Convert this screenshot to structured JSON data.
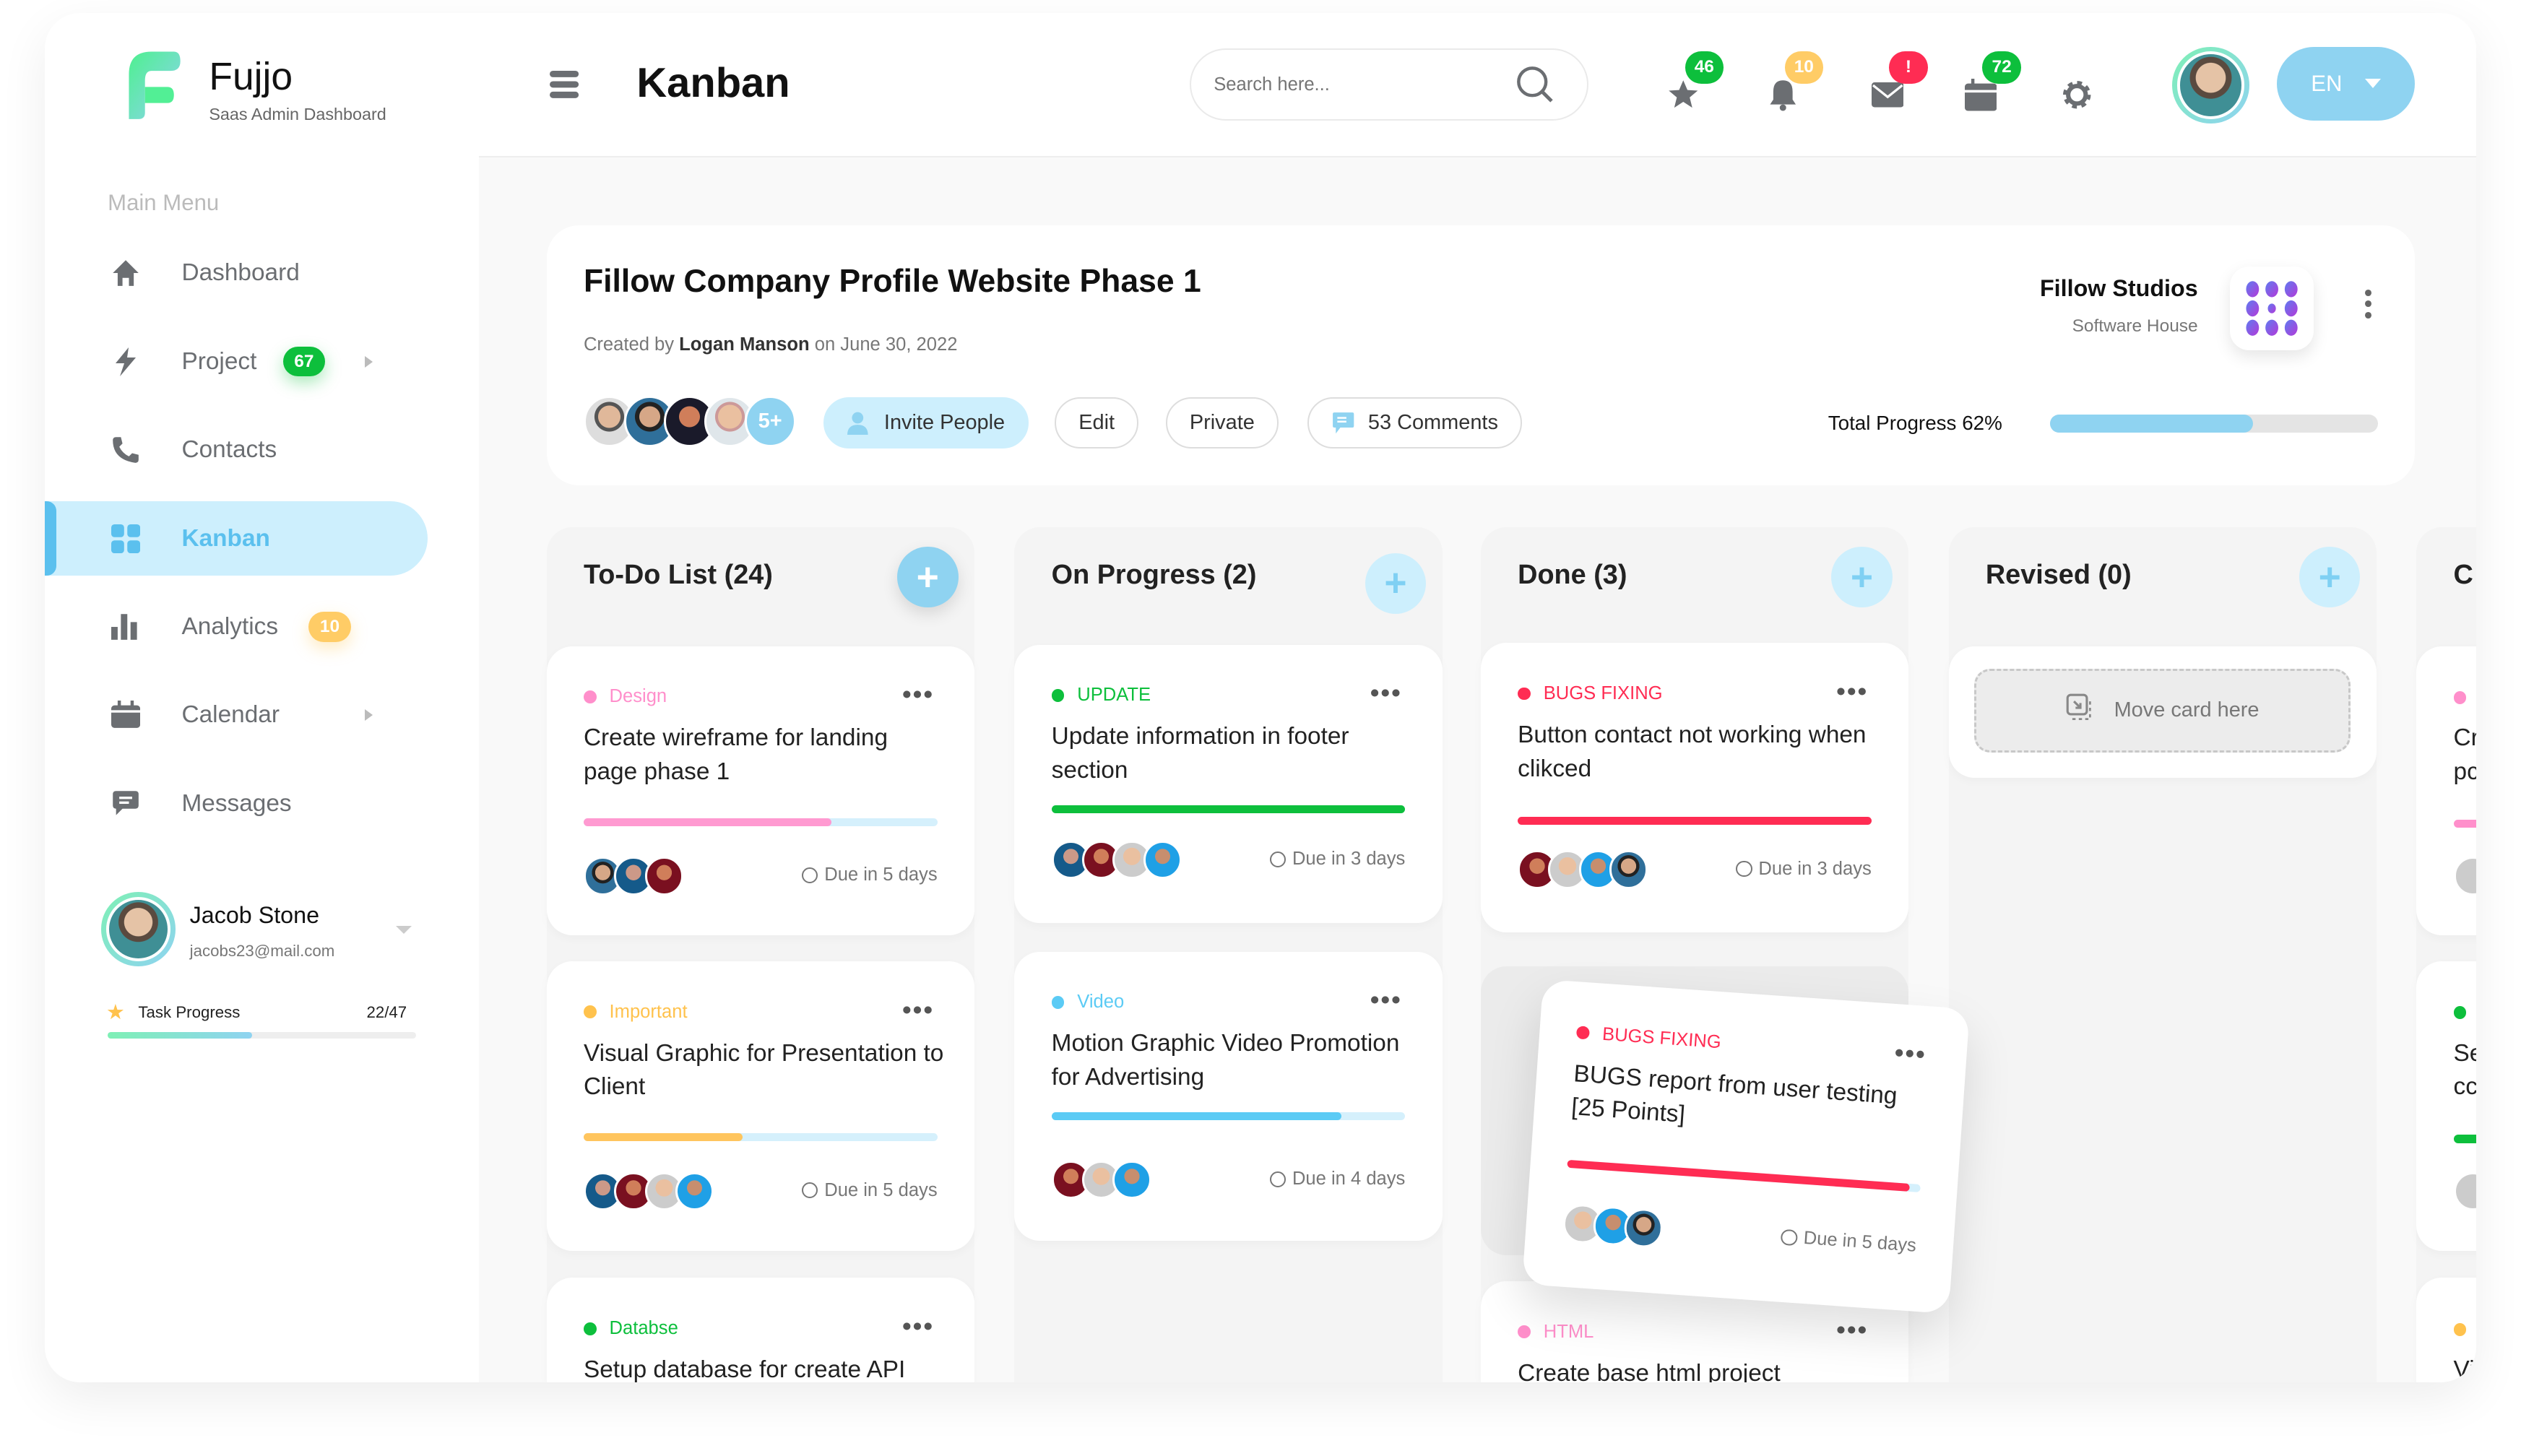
{
  "brand": {
    "name": "Fujjo",
    "subtitle": "Saas Admin Dashboard"
  },
  "sidebar": {
    "section_label": "Main Menu",
    "items": [
      {
        "label": "Dashboard",
        "icon": "home-icon"
      },
      {
        "label": "Project",
        "icon": "lightning-icon",
        "badge": "67",
        "badge_color": "#0dbf3c",
        "has_submenu": true
      },
      {
        "label": "Contacts",
        "icon": "phone-icon"
      },
      {
        "label": "Kanban",
        "icon": "grid-icon",
        "active": true
      },
      {
        "label": "Analytics",
        "icon": "bar-chart-icon",
        "badge": "10",
        "badge_color": "#ffcc66"
      },
      {
        "label": "Calendar",
        "icon": "calendar-icon",
        "has_submenu": true
      },
      {
        "label": "Messages",
        "icon": "message-icon"
      }
    ],
    "user": {
      "name": "Jacob Stone",
      "email": "jacobs23@mail.com",
      "task_progress_label": "Task Progress",
      "task_progress": "22/47",
      "task_progress_fraction": 0.468
    }
  },
  "header": {
    "title": "Kanban",
    "search_placeholder": "Search here...",
    "icons": [
      {
        "name": "star-icon",
        "badge": "46",
        "badge_color": "#0dbf3c"
      },
      {
        "name": "bell-icon",
        "badge": "10",
        "badge_color": "#ffcc66"
      },
      {
        "name": "mail-icon",
        "badge": "!",
        "badge_color": "#ff2c53"
      },
      {
        "name": "calendar-icon",
        "badge": "72",
        "badge_color": "#0dbf3c"
      },
      {
        "name": "gear-icon"
      }
    ],
    "language": "EN"
  },
  "project": {
    "title": "Fillow Company Profile Website Phase 1",
    "created_prefix": "Created by",
    "author": "Logan Manson",
    "created_suffix": "on June 30, 2022",
    "more_members": "5+",
    "invite_label": "Invite People",
    "edit_label": "Edit",
    "private_label": "Private",
    "comments_label": "53 Comments",
    "company": "Fillow Studios",
    "company_type": "Software House",
    "progress_label": "Total Progress 62%",
    "progress": 62
  },
  "accent": "#8fd3f1",
  "columns": [
    {
      "title": "To-Do List (24)",
      "cards": [
        {
          "tag": "Design",
          "tag_color": "#ff8fcb",
          "title": "Create wireframe for landing page phase 1",
          "progress": 70,
          "bar_color": "#ff9ad1",
          "due": "Due in 5 days",
          "avatars": 3
        },
        {
          "tag": "Important",
          "tag_color": "#ffc24d",
          "title": "Visual Graphic for Presentation to Client",
          "progress": 45,
          "bar_color": "#ffc55e",
          "due": "Due in 5 days",
          "avatars": 4
        },
        {
          "tag": "Databse",
          "tag_color": "#0dbf3c",
          "title": "Setup database for create API",
          "progress": 0,
          "bar_color": "#0dbf3c",
          "due": "",
          "avatars": 0
        }
      ]
    },
    {
      "title": "On Progress (2)",
      "cards": [
        {
          "tag": "UPDATE",
          "tag_color": "#0dbf3c",
          "title": "Update information in footer section",
          "progress": 100,
          "bar_color": "#0dbf3c",
          "due": "Due in 3 days",
          "avatars": 4
        },
        {
          "tag": "Video",
          "tag_color": "#5bcbf5",
          "title": "Motion Graphic Video Promotion for Advertising",
          "progress": 82,
          "bar_color": "#5bcbf5",
          "due": "Due in 4  days",
          "avatars": 3
        }
      ]
    },
    {
      "title": "Done (3)",
      "cards": [
        {
          "tag": "BUGS FIXING",
          "tag_color": "#ff2c53",
          "title": "Button contact not working when clikced",
          "progress": 100,
          "bar_color": "#ff2c53",
          "due": "Due in 3 days",
          "avatars": 4
        },
        {
          "tag": "BUGS FIXING",
          "tag_color": "#ff2c53",
          "title": "BUGS report from user testing [25 Points]",
          "progress": 97,
          "bar_color": "#ff2c53",
          "due": "Due in 5 days",
          "avatars": 3,
          "dragging": true
        },
        {
          "tag": "HTML",
          "tag_color": "#ff8fcb",
          "title": "Create base html project",
          "progress": 0,
          "bar_color": "#ff8fcb",
          "due": "",
          "avatars": 0
        }
      ]
    },
    {
      "title": "Revised (0)",
      "placeholder": "Move card here",
      "cards": []
    },
    {
      "title": "C",
      "cards": [
        {
          "title_fragment": "Cr",
          "title_fragment2": "pc",
          "tag_color": "#ff8fcb"
        },
        {
          "title_fragment": "Se",
          "title_fragment2": "cc",
          "tag_color": "#0dbf3c"
        },
        {
          "title_fragment": "Vi",
          "tag_color": "#ffc24d"
        }
      ]
    }
  ]
}
